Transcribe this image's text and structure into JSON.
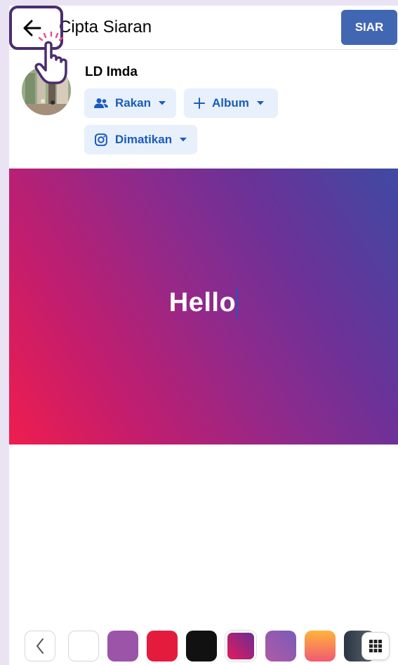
{
  "header": {
    "title": "Cipta Siaran",
    "post_label": "SIAR"
  },
  "user": {
    "name": "LD Imda"
  },
  "controls": {
    "audience_label": "Rakan",
    "album_label": "Album",
    "instagram_label": "Dimatikan"
  },
  "composer": {
    "text": "Hello"
  },
  "colors": {
    "accent": "#4267b2",
    "pill_bg": "#e7f0fb",
    "pill_text": "#1b5cba"
  },
  "swatches": [
    {
      "name": "white",
      "fill": "#ffffff"
    },
    {
      "name": "purple",
      "fill": "#9b54a8"
    },
    {
      "name": "red",
      "fill": "#e41b3d"
    },
    {
      "name": "black",
      "fill": "#111111"
    },
    {
      "name": "magenta-gradient",
      "fill": "linear-gradient(45deg,#e41b5a,#6a2c96)"
    },
    {
      "name": "violet-gradient",
      "fill": "linear-gradient(45deg,#b05aa6,#7a5bb8)"
    },
    {
      "name": "orange-gradient",
      "fill": "linear-gradient(180deg,#ffb33a,#f25a72)"
    },
    {
      "name": "slate-gradient",
      "fill": "linear-gradient(90deg,#2b3440,#5c6775)"
    }
  ],
  "icons": {
    "back": "arrow-left-icon",
    "audience": "friends-icon",
    "album": "plus-icon",
    "instagram": "instagram-icon",
    "dropdown": "caret-down-icon",
    "prev": "chevron-left-icon",
    "grid": "grid-icon"
  }
}
